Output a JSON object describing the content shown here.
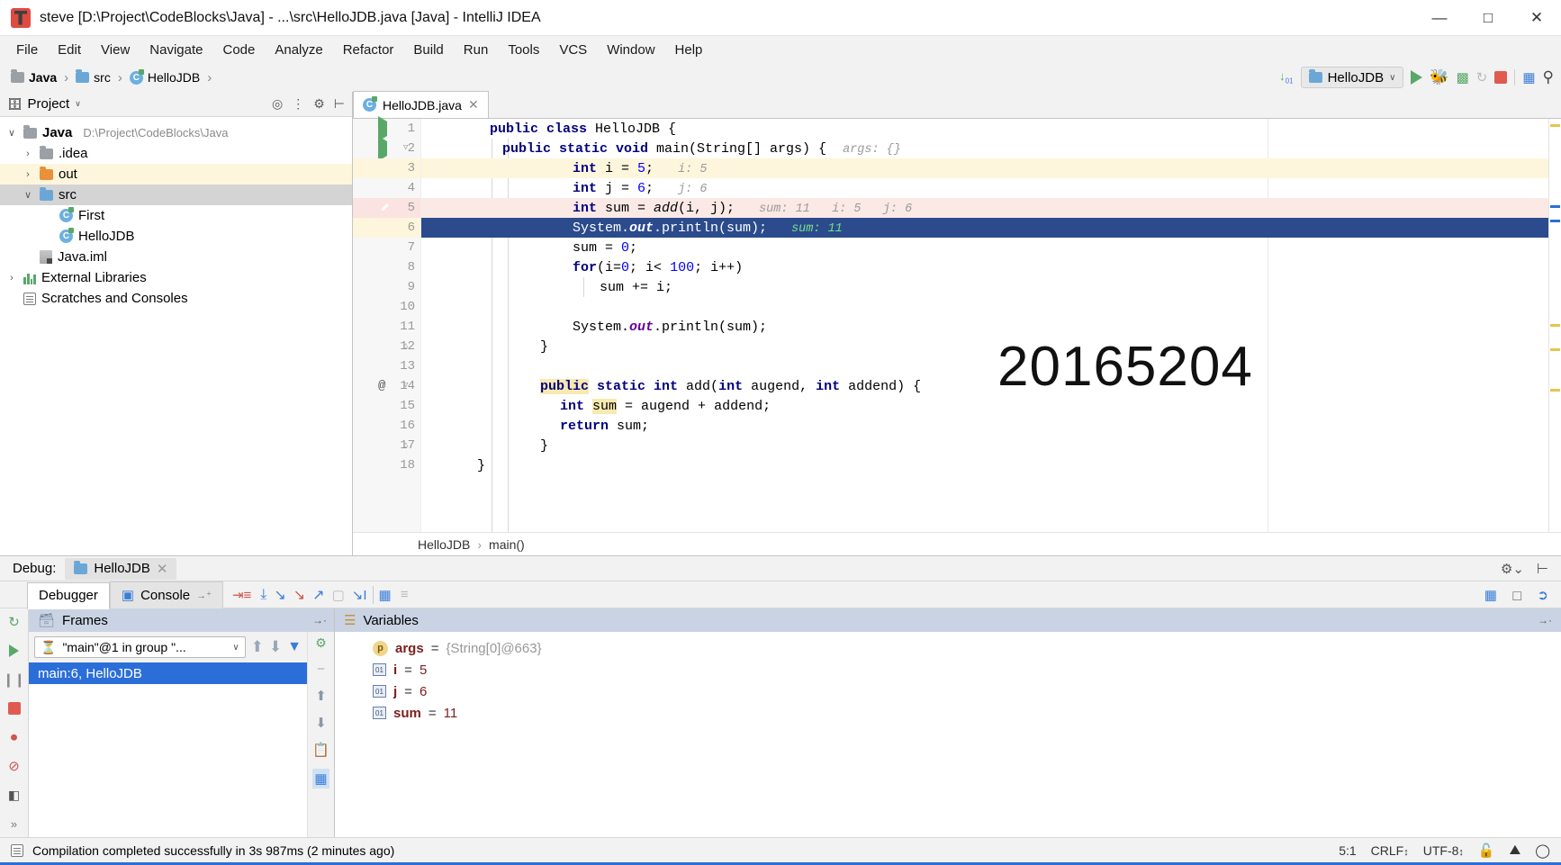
{
  "window": {
    "title": "steve [D:\\Project\\CodeBlocks\\Java] - ...\\src\\HelloJDB.java [Java] - IntelliJ IDEA",
    "minimize": "—",
    "maximize": "□",
    "close": "✕"
  },
  "menu": [
    "File",
    "Edit",
    "View",
    "Navigate",
    "Code",
    "Analyze",
    "Refactor",
    "Build",
    "Run",
    "Tools",
    "VCS",
    "Window",
    "Help"
  ],
  "breadcrumb": [
    {
      "label": "Java",
      "icon": "module-icon"
    },
    {
      "label": "src",
      "icon": "folder-icon"
    },
    {
      "label": "HelloJDB",
      "icon": "class-icon"
    }
  ],
  "toolbar": {
    "sort_icon": "sort-numeric-icon",
    "run_config": "HelloJDB",
    "run_config_icon": "run-config-icon",
    "dropdown_arrow": "∨",
    "run": "run-icon",
    "debug": "debug-icon",
    "coverage": "run-coverage-icon",
    "profile": "profiler-icon",
    "stop": "stop-icon",
    "layout": "project-structure-icon",
    "search": "search-icon"
  },
  "project_panel": {
    "title": "Project",
    "title_chevron": "▾",
    "actions": [
      "locate-icon",
      "collapse-all-icon",
      "gear-icon",
      "hide-icon"
    ],
    "tree": [
      {
        "label": "Java",
        "path": "D:\\Project\\CodeBlocks\\Java",
        "icon": "module-icon",
        "twisty": "∨",
        "indent": 0,
        "bold": true,
        "state": "normal"
      },
      {
        "label": ".idea",
        "icon": "folder-icon",
        "twisty": "›",
        "indent": 1,
        "state": "normal"
      },
      {
        "label": "out",
        "icon": "folder-orange-icon",
        "twisty": "›",
        "indent": 1,
        "state": "highlight"
      },
      {
        "label": "src",
        "icon": "folder-blue-icon",
        "twisty": "∨",
        "indent": 1,
        "state": "selected"
      },
      {
        "label": "First",
        "icon": "class-icon",
        "twisty": "",
        "indent": 2,
        "state": "normal"
      },
      {
        "label": "HelloJDB",
        "icon": "class-icon",
        "twisty": "",
        "indent": 2,
        "state": "normal"
      },
      {
        "label": "Java.iml",
        "icon": "iml-icon",
        "twisty": "",
        "indent": 1,
        "state": "normal"
      },
      {
        "label": "External Libraries",
        "icon": "library-icon",
        "twisty": "›",
        "indent": 0,
        "state": "normal"
      },
      {
        "label": "Scratches and Consoles",
        "icon": "scratches-icon",
        "twisty": "",
        "indent": 0,
        "state": "normal"
      }
    ]
  },
  "editor": {
    "tab": {
      "label": "HelloJDB.java",
      "icon": "class-icon",
      "close": "✕"
    },
    "watermark": "20165204",
    "breadcrumb": [
      "HelloJDB",
      "main()"
    ],
    "breadcrumb_sep": "›",
    "lines": [
      {
        "n": 1,
        "gutter": "run-icon",
        "fold": "",
        "state": "normal"
      },
      {
        "n": 2,
        "gutter": "run-icon",
        "fold": "minus",
        "state": "normal"
      },
      {
        "n": 3,
        "gutter": "",
        "fold": "",
        "state": "highlight"
      },
      {
        "n": 4,
        "gutter": "",
        "fold": "",
        "state": "normal"
      },
      {
        "n": 5,
        "gutter": "breakpoint-verified-icon",
        "fold": "",
        "state": "error"
      },
      {
        "n": 6,
        "gutter": "",
        "fold": "",
        "state": "current"
      },
      {
        "n": 7,
        "gutter": "",
        "fold": "",
        "state": "normal"
      },
      {
        "n": 8,
        "gutter": "",
        "fold": "",
        "state": "normal"
      },
      {
        "n": 9,
        "gutter": "",
        "fold": "",
        "state": "normal"
      },
      {
        "n": 10,
        "gutter": "",
        "fold": "",
        "state": "normal"
      },
      {
        "n": 11,
        "gutter": "",
        "fold": "",
        "state": "normal"
      },
      {
        "n": 12,
        "gutter": "",
        "fold": "up",
        "state": "normal"
      },
      {
        "n": 13,
        "gutter": "",
        "fold": "",
        "state": "normal"
      },
      {
        "n": 14,
        "gutter": "annotation-icon",
        "fold": "down",
        "state": "normal"
      },
      {
        "n": 15,
        "gutter": "",
        "fold": "",
        "state": "normal"
      },
      {
        "n": 16,
        "gutter": "",
        "fold": "",
        "state": "normal"
      },
      {
        "n": 17,
        "gutter": "",
        "fold": "up",
        "state": "normal"
      },
      {
        "n": 18,
        "gutter": "",
        "fold": "",
        "state": "normal"
      }
    ],
    "code": [
      "public class HelloJDB {",
      "  public static void main(String[] args) {     args: {}",
      "        int i = 5;   i: 5",
      "        int j = 6;   j: 6",
      "        int sum = add(i, j);   sum: 11  i: 5  j: 6",
      "        System.out.println(sum);   sum: 11",
      "        sum = 0;",
      "        for(i=0; i< 100; i++)",
      "            sum += i;",
      "",
      "        System.out.println(sum);",
      "  }",
      "",
      "  public static int add(int augend, int addend) {",
      "    int sum = augend + addend;",
      "    return sum;",
      "  }",
      "}"
    ],
    "hints": {
      "line2": "args: {}",
      "line3": "i: 5",
      "line4": "j: 6",
      "line5": "sum: 11   i: 5   j: 6",
      "line6": "sum: 11"
    }
  },
  "debug": {
    "label": "Debug:",
    "session": "HelloJDB",
    "session_close": "✕",
    "settings_icon": "gear-icon",
    "hide_icon": "hide-icon",
    "tabs": [
      {
        "label": "Debugger",
        "icon": "",
        "active": true
      },
      {
        "label": "Console",
        "icon": "console-icon",
        "active": false,
        "pin": "→⁺"
      }
    ],
    "toolbar_icons": [
      "rerun-icon",
      "resume-icon",
      "pause-icon",
      "stop-icon",
      "view-breakpoints-icon",
      "mute-breakpoints-icon",
      "settings-icon",
      "show-execution-point-icon",
      "step-over-icon",
      "step-into-icon",
      "force-step-into-icon",
      "step-out-icon",
      "drop-frame-icon",
      "run-to-cursor-icon",
      "evaluate-expression-icon",
      "layout-icon"
    ],
    "frames": {
      "title": "Frames",
      "title_icon": "frames-icon",
      "pin_icon": "→·",
      "thread": "\"main\"@1 in group \"...",
      "thread_icon": "thread-suspended-icon",
      "thread_chevron": "∨",
      "up_icon": "↑",
      "down_icon": "↓",
      "filter_icon": "filter-icon",
      "rows": [
        {
          "label": "main:6, HelloJDB",
          "selected": true
        }
      ],
      "rail_icons": [
        "customize-threads-icon",
        "minus-icon",
        "up-icon",
        "down-icon",
        "copy-icon",
        "settings-icon"
      ]
    },
    "variables": {
      "title": "Variables",
      "title_icon": "variables-icon",
      "hide_icon": "→·",
      "rows": [
        {
          "icon": "param-icon",
          "name": "args",
          "eq": "=",
          "value": "{String[0]@663}",
          "value_kind": "object"
        },
        {
          "icon": "primitive-icon",
          "name": "i",
          "eq": "=",
          "value": "5",
          "value_kind": "number"
        },
        {
          "icon": "primitive-icon",
          "name": "j",
          "eq": "=",
          "value": "6",
          "value_kind": "number"
        },
        {
          "icon": "primitive-icon",
          "name": "sum",
          "eq": "=",
          "value": "11",
          "value_kind": "number"
        }
      ]
    },
    "expand_more": "»"
  },
  "statusbar": {
    "icon": "event-log-icon",
    "message": "Compilation completed successfully in 3s 987ms (2 minutes ago)",
    "caret": "5:1",
    "line_sep": "CRLF",
    "line_sep_arrow": "↕",
    "encoding": "UTF-8",
    "encoding_arrow": "↕",
    "lock_icon": "lock-icon",
    "inspection_icon": "inspection-icon",
    "balloon_icon": "notifications-icon"
  },
  "colors": {
    "accent_blue": "#2b6ed9",
    "current_line": "#2b4b8c",
    "error_line": "#fbe9e6",
    "highlight_yellow": "#fdf6dd",
    "green": "#59a869",
    "red": "#e05a4f"
  }
}
